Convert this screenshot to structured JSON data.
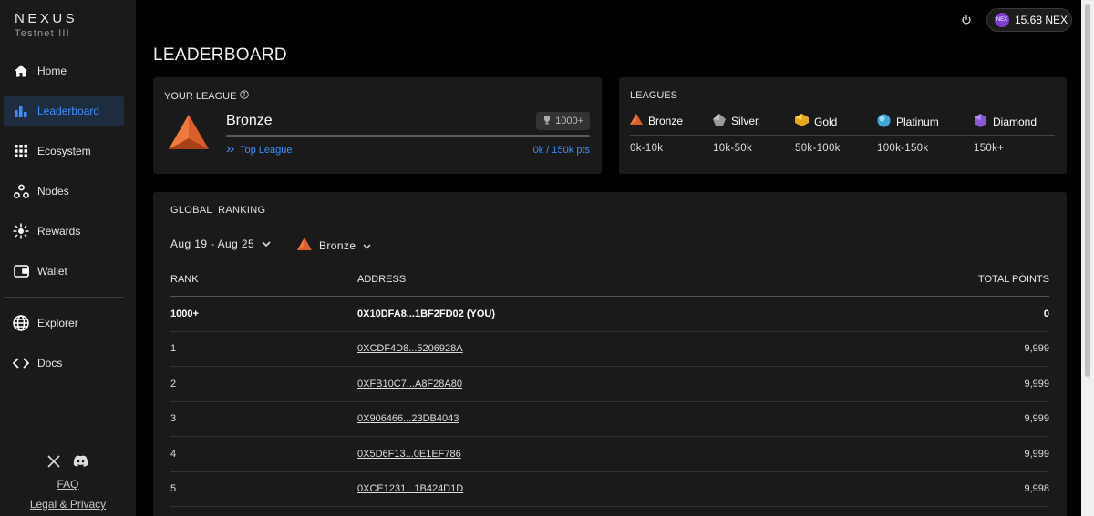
{
  "brand": {
    "name": "NEXUS",
    "network": "Testnet III"
  },
  "nav": {
    "items": [
      {
        "label": "Home",
        "icon": "home-icon"
      },
      {
        "label": "Leaderboard",
        "icon": "bar-chart-icon",
        "active": true
      },
      {
        "label": "Ecosystem",
        "icon": "grid-icon"
      },
      {
        "label": "Nodes",
        "icon": "nodes-icon"
      },
      {
        "label": "Rewards",
        "icon": "sparkle-icon"
      },
      {
        "label": "Wallet",
        "icon": "wallet-icon"
      }
    ],
    "secondary": [
      {
        "label": "Explorer",
        "icon": "globe-icon"
      },
      {
        "label": "Docs",
        "icon": "code-icon"
      }
    ],
    "footer": {
      "faq": "FAQ",
      "legal": "Legal & Privacy"
    }
  },
  "topbar": {
    "balance": "15.68 NEX",
    "token_icon_text": "NEX"
  },
  "page_title": "LEADERBOARD",
  "your_league": {
    "title": "YOUR LEAGUE",
    "league": "Bronze",
    "rank_badge": "1000+",
    "top_league_label": "Top League",
    "points": "0k / 150k pts",
    "progress_fraction": 0
  },
  "leagues": {
    "title": "LEAGUES",
    "items": [
      {
        "name": "Bronze",
        "range": "0k-10k",
        "color": "#d9602c"
      },
      {
        "name": "Silver",
        "range": "10k-50k",
        "color": "#9a9a9a"
      },
      {
        "name": "Gold",
        "range": "50k-100k",
        "color": "#e8a91c"
      },
      {
        "name": "Platinum",
        "range": "100k-150k",
        "color": "#3fa7d9"
      },
      {
        "name": "Diamond",
        "range": "150k+",
        "color": "#8a5ad6"
      }
    ]
  },
  "ranking": {
    "title": "GLOBAL  RANKING",
    "date_filter": "Aug 19 - Aug 25",
    "league_filter": "Bronze",
    "columns": {
      "rank": "RANK",
      "address": "ADDRESS",
      "points": "TOTAL POINTS"
    },
    "you": {
      "rank": "1000+",
      "address": "0X10DFA8...1BF2FD02 (YOU)",
      "points": "0"
    },
    "rows": [
      {
        "rank": "1",
        "address": "0XCDF4D8...5206928A",
        "points": "9,999"
      },
      {
        "rank": "2",
        "address": "0XFB10C7...A8F28A80",
        "points": "9,999"
      },
      {
        "rank": "3",
        "address": "0X906466...23DB4043",
        "points": "9,999"
      },
      {
        "rank": "4",
        "address": "0X5D6F13...0E1EF786",
        "points": "9,999"
      },
      {
        "rank": "5",
        "address": "0XCE1231...1B424D1D",
        "points": "9,998"
      }
    ]
  }
}
